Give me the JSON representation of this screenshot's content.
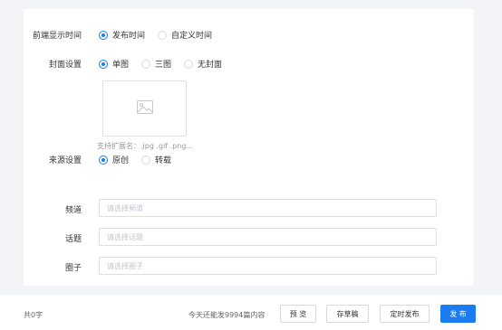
{
  "form": {
    "display_time": {
      "label": "前端显示时间",
      "options": [
        "发布时间",
        "自定义时间"
      ],
      "selected": "发布时间"
    },
    "cover": {
      "label": "封面设置",
      "options": [
        "单图",
        "三图",
        "无封面"
      ],
      "selected": "单图",
      "hint": "支持扩展名：.jpg .gif .png..."
    },
    "source": {
      "label": "来源设置",
      "options": [
        "原创",
        "转载"
      ],
      "selected": "原创"
    },
    "channel": {
      "label": "频道",
      "placeholder": "请选择频道"
    },
    "topic": {
      "label": "话题",
      "placeholder": "请选择话题"
    },
    "circle": {
      "label": "圈子",
      "placeholder": "请选择圈子"
    }
  },
  "footer": {
    "word_count": "共0字",
    "remaining": "今天还能发9994篇内容",
    "preview_label": "预 览",
    "draft_label": "存草稿",
    "schedule_label": "定时发布",
    "publish_label": "发 布"
  },
  "colors": {
    "accent": "#1a7cf0",
    "background": "#f3f4f7"
  },
  "icons": {
    "cover_placeholder": "image-icon"
  }
}
